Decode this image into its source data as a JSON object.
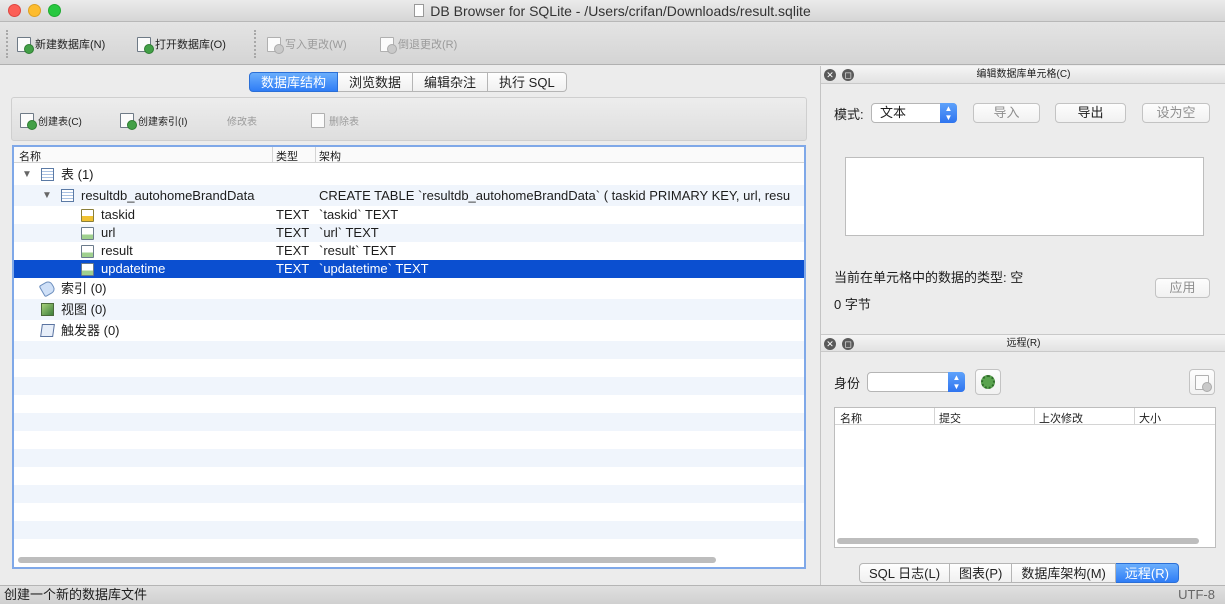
{
  "window": {
    "title": "DB Browser for SQLite - /Users/crifan/Downloads/result.sqlite"
  },
  "toolbar": {
    "new_db": "新建数据库(N)",
    "open_db": "打开数据库(O)",
    "write_changes": "写入更改(W)",
    "revert_changes": "倒退更改(R)"
  },
  "main_tabs": [
    "数据库结构",
    "浏览数据",
    "编辑杂注",
    "执行 SQL"
  ],
  "structure_toolbar": {
    "create_table": "创建表(C)",
    "create_index": "创建索引(I)",
    "modify_table": "修改表",
    "delete_table": "删除表"
  },
  "tree": {
    "columns": [
      "名称",
      "类型",
      "架构"
    ],
    "tables_node": "表 (1)",
    "table_name": "resultdb_autohomeBrandData",
    "table_schema": "CREATE TABLE `resultdb_autohomeBrandData` ( taskid PRIMARY KEY, url, resu",
    "fields": [
      {
        "name": "taskid",
        "type": "TEXT",
        "schema": "`taskid` TEXT",
        "icon": "key-field-icon"
      },
      {
        "name": "url",
        "type": "TEXT",
        "schema": "`url` TEXT",
        "icon": "field-icon"
      },
      {
        "name": "result",
        "type": "TEXT",
        "schema": "`result` TEXT",
        "icon": "field-icon"
      },
      {
        "name": "updatetime",
        "type": "TEXT",
        "schema": "`updatetime` TEXT",
        "icon": "field-icon"
      }
    ],
    "indexes_node": "索引 (0)",
    "views_node": "视图 (0)",
    "triggers_node": "触发器 (0)"
  },
  "edit_cell": {
    "title": "编辑数据库单元格(C)",
    "mode_label": "模式:",
    "mode_value": "文本",
    "import": "导入",
    "export": "导出",
    "set_null": "设为空",
    "type_info": "当前在单元格中的数据的类型: 空",
    "size_info": "0 字节",
    "apply": "应用"
  },
  "remote": {
    "title": "远程(R)",
    "identity_label": "身份",
    "columns": [
      "名称",
      "提交",
      "上次修改",
      "大小"
    ]
  },
  "bottom_tabs": [
    "SQL 日志(L)",
    "图表(P)",
    "数据库架构(M)",
    "远程(R)"
  ],
  "status": {
    "message": "创建一个新的数据库文件",
    "encoding": "UTF-8"
  },
  "colors": {
    "accent": "#2f7df6",
    "selection": "#0b4fd0"
  }
}
